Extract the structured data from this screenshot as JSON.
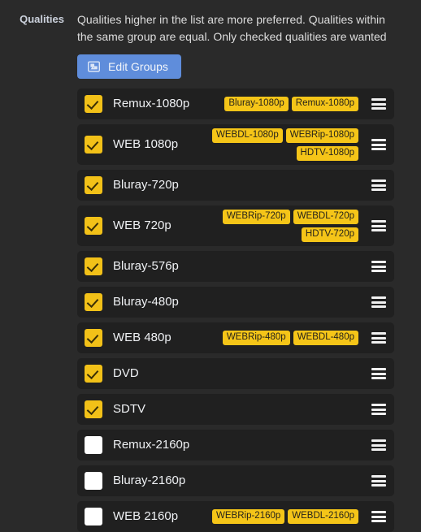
{
  "section": {
    "label": "Qualities",
    "helptext": "Qualities higher in the list are more preferred. Qualities within the same group are equal. Only checked qualities are wanted",
    "edit_groups_button": "Edit Groups",
    "edit_groups_icon": "image-group-icon",
    "drag_handle_icon": "drag-handle-icon",
    "colors": {
      "page_background": "#2a2a2a",
      "row_background": "#202020",
      "checkbox_checked": "#f2c118",
      "badge_background": "#f5c518",
      "badge_text": "#26231a",
      "button_background": "#5f8ddb",
      "title_text": "#eff1f4"
    }
  },
  "qualities": [
    {
      "name": "Remux-1080p",
      "checked": true,
      "badges": [
        "Bluray-1080p",
        "Remux-1080p"
      ]
    },
    {
      "name": "WEB 1080p",
      "checked": true,
      "badges": [
        "WEBDL-1080p",
        "WEBRip-1080p",
        "HDTV-1080p"
      ]
    },
    {
      "name": "Bluray-720p",
      "checked": true,
      "badges": []
    },
    {
      "name": "WEB 720p",
      "checked": true,
      "badges": [
        "WEBRip-720p",
        "WEBDL-720p",
        "HDTV-720p"
      ]
    },
    {
      "name": "Bluray-576p",
      "checked": true,
      "badges": []
    },
    {
      "name": "Bluray-480p",
      "checked": true,
      "badges": []
    },
    {
      "name": "WEB 480p",
      "checked": true,
      "badges": [
        "WEBRip-480p",
        "WEBDL-480p"
      ]
    },
    {
      "name": "DVD",
      "checked": true,
      "badges": []
    },
    {
      "name": "SDTV",
      "checked": true,
      "badges": []
    },
    {
      "name": "Remux-2160p",
      "checked": false,
      "badges": []
    },
    {
      "name": "Bluray-2160p",
      "checked": false,
      "badges": []
    },
    {
      "name": "WEB 2160p",
      "checked": false,
      "badges": [
        "WEBRip-2160p",
        "WEBDL-2160p"
      ]
    }
  ]
}
